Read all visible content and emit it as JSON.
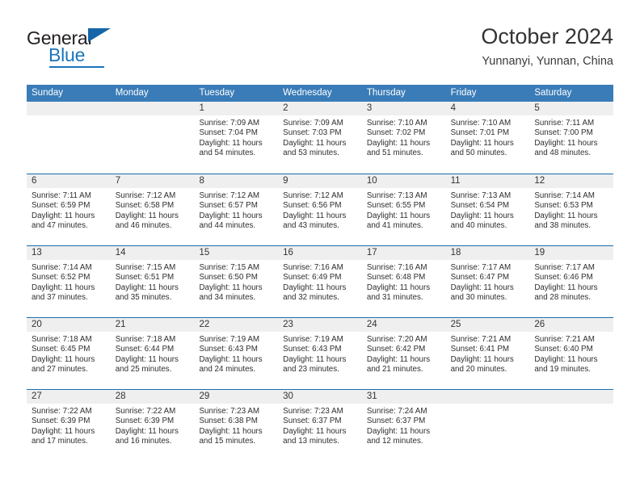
{
  "brand": {
    "name_top": "General",
    "name_bottom": "Blue",
    "accent_color": "#1b75bb",
    "triangle_color": "#1566a8"
  },
  "header": {
    "title": "October 2024",
    "subtitle": "Yunnanyi, Yunnan, China"
  },
  "calendar": {
    "header_bg": "#3a7cb8",
    "row_divider_color": "#1b6cab",
    "daynum_band_bg": "#efefef",
    "weekdays": [
      "Sunday",
      "Monday",
      "Tuesday",
      "Wednesday",
      "Thursday",
      "Friday",
      "Saturday"
    ],
    "weeks": [
      [
        {
          "day": "",
          "empty": true
        },
        {
          "day": "",
          "empty": true
        },
        {
          "day": "1",
          "sunrise": "Sunrise: 7:09 AM",
          "sunset": "Sunset: 7:04 PM",
          "daylight_line1": "Daylight: 11 hours",
          "daylight_line2": "and 54 minutes."
        },
        {
          "day": "2",
          "sunrise": "Sunrise: 7:09 AM",
          "sunset": "Sunset: 7:03 PM",
          "daylight_line1": "Daylight: 11 hours",
          "daylight_line2": "and 53 minutes."
        },
        {
          "day": "3",
          "sunrise": "Sunrise: 7:10 AM",
          "sunset": "Sunset: 7:02 PM",
          "daylight_line1": "Daylight: 11 hours",
          "daylight_line2": "and 51 minutes."
        },
        {
          "day": "4",
          "sunrise": "Sunrise: 7:10 AM",
          "sunset": "Sunset: 7:01 PM",
          "daylight_line1": "Daylight: 11 hours",
          "daylight_line2": "and 50 minutes."
        },
        {
          "day": "5",
          "sunrise": "Sunrise: 7:11 AM",
          "sunset": "Sunset: 7:00 PM",
          "daylight_line1": "Daylight: 11 hours",
          "daylight_line2": "and 48 minutes."
        }
      ],
      [
        {
          "day": "6",
          "sunrise": "Sunrise: 7:11 AM",
          "sunset": "Sunset: 6:59 PM",
          "daylight_line1": "Daylight: 11 hours",
          "daylight_line2": "and 47 minutes."
        },
        {
          "day": "7",
          "sunrise": "Sunrise: 7:12 AM",
          "sunset": "Sunset: 6:58 PM",
          "daylight_line1": "Daylight: 11 hours",
          "daylight_line2": "and 46 minutes."
        },
        {
          "day": "8",
          "sunrise": "Sunrise: 7:12 AM",
          "sunset": "Sunset: 6:57 PM",
          "daylight_line1": "Daylight: 11 hours",
          "daylight_line2": "and 44 minutes."
        },
        {
          "day": "9",
          "sunrise": "Sunrise: 7:12 AM",
          "sunset": "Sunset: 6:56 PM",
          "daylight_line1": "Daylight: 11 hours",
          "daylight_line2": "and 43 minutes."
        },
        {
          "day": "10",
          "sunrise": "Sunrise: 7:13 AM",
          "sunset": "Sunset: 6:55 PM",
          "daylight_line1": "Daylight: 11 hours",
          "daylight_line2": "and 41 minutes."
        },
        {
          "day": "11",
          "sunrise": "Sunrise: 7:13 AM",
          "sunset": "Sunset: 6:54 PM",
          "daylight_line1": "Daylight: 11 hours",
          "daylight_line2": "and 40 minutes."
        },
        {
          "day": "12",
          "sunrise": "Sunrise: 7:14 AM",
          "sunset": "Sunset: 6:53 PM",
          "daylight_line1": "Daylight: 11 hours",
          "daylight_line2": "and 38 minutes."
        }
      ],
      [
        {
          "day": "13",
          "sunrise": "Sunrise: 7:14 AM",
          "sunset": "Sunset: 6:52 PM",
          "daylight_line1": "Daylight: 11 hours",
          "daylight_line2": "and 37 minutes."
        },
        {
          "day": "14",
          "sunrise": "Sunrise: 7:15 AM",
          "sunset": "Sunset: 6:51 PM",
          "daylight_line1": "Daylight: 11 hours",
          "daylight_line2": "and 35 minutes."
        },
        {
          "day": "15",
          "sunrise": "Sunrise: 7:15 AM",
          "sunset": "Sunset: 6:50 PM",
          "daylight_line1": "Daylight: 11 hours",
          "daylight_line2": "and 34 minutes."
        },
        {
          "day": "16",
          "sunrise": "Sunrise: 7:16 AM",
          "sunset": "Sunset: 6:49 PM",
          "daylight_line1": "Daylight: 11 hours",
          "daylight_line2": "and 32 minutes."
        },
        {
          "day": "17",
          "sunrise": "Sunrise: 7:16 AM",
          "sunset": "Sunset: 6:48 PM",
          "daylight_line1": "Daylight: 11 hours",
          "daylight_line2": "and 31 minutes."
        },
        {
          "day": "18",
          "sunrise": "Sunrise: 7:17 AM",
          "sunset": "Sunset: 6:47 PM",
          "daylight_line1": "Daylight: 11 hours",
          "daylight_line2": "and 30 minutes."
        },
        {
          "day": "19",
          "sunrise": "Sunrise: 7:17 AM",
          "sunset": "Sunset: 6:46 PM",
          "daylight_line1": "Daylight: 11 hours",
          "daylight_line2": "and 28 minutes."
        }
      ],
      [
        {
          "day": "20",
          "sunrise": "Sunrise: 7:18 AM",
          "sunset": "Sunset: 6:45 PM",
          "daylight_line1": "Daylight: 11 hours",
          "daylight_line2": "and 27 minutes."
        },
        {
          "day": "21",
          "sunrise": "Sunrise: 7:18 AM",
          "sunset": "Sunset: 6:44 PM",
          "daylight_line1": "Daylight: 11 hours",
          "daylight_line2": "and 25 minutes."
        },
        {
          "day": "22",
          "sunrise": "Sunrise: 7:19 AM",
          "sunset": "Sunset: 6:43 PM",
          "daylight_line1": "Daylight: 11 hours",
          "daylight_line2": "and 24 minutes."
        },
        {
          "day": "23",
          "sunrise": "Sunrise: 7:19 AM",
          "sunset": "Sunset: 6:43 PM",
          "daylight_line1": "Daylight: 11 hours",
          "daylight_line2": "and 23 minutes."
        },
        {
          "day": "24",
          "sunrise": "Sunrise: 7:20 AM",
          "sunset": "Sunset: 6:42 PM",
          "daylight_line1": "Daylight: 11 hours",
          "daylight_line2": "and 21 minutes."
        },
        {
          "day": "25",
          "sunrise": "Sunrise: 7:21 AM",
          "sunset": "Sunset: 6:41 PM",
          "daylight_line1": "Daylight: 11 hours",
          "daylight_line2": "and 20 minutes."
        },
        {
          "day": "26",
          "sunrise": "Sunrise: 7:21 AM",
          "sunset": "Sunset: 6:40 PM",
          "daylight_line1": "Daylight: 11 hours",
          "daylight_line2": "and 19 minutes."
        }
      ],
      [
        {
          "day": "27",
          "sunrise": "Sunrise: 7:22 AM",
          "sunset": "Sunset: 6:39 PM",
          "daylight_line1": "Daylight: 11 hours",
          "daylight_line2": "and 17 minutes."
        },
        {
          "day": "28",
          "sunrise": "Sunrise: 7:22 AM",
          "sunset": "Sunset: 6:39 PM",
          "daylight_line1": "Daylight: 11 hours",
          "daylight_line2": "and 16 minutes."
        },
        {
          "day": "29",
          "sunrise": "Sunrise: 7:23 AM",
          "sunset": "Sunset: 6:38 PM",
          "daylight_line1": "Daylight: 11 hours",
          "daylight_line2": "and 15 minutes."
        },
        {
          "day": "30",
          "sunrise": "Sunrise: 7:23 AM",
          "sunset": "Sunset: 6:37 PM",
          "daylight_line1": "Daylight: 11 hours",
          "daylight_line2": "and 13 minutes."
        },
        {
          "day": "31",
          "sunrise": "Sunrise: 7:24 AM",
          "sunset": "Sunset: 6:37 PM",
          "daylight_line1": "Daylight: 11 hours",
          "daylight_line2": "and 12 minutes."
        },
        {
          "day": "",
          "empty": true
        },
        {
          "day": "",
          "empty": true
        }
      ]
    ]
  }
}
